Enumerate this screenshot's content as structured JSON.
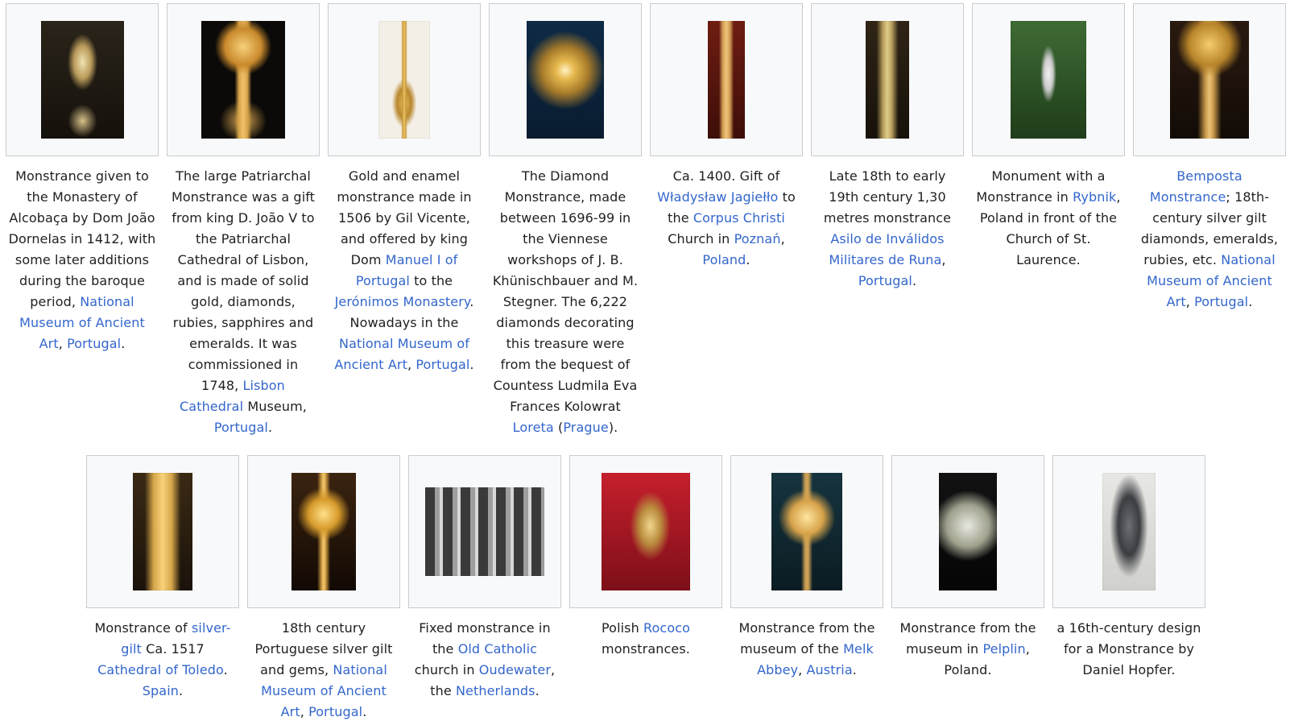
{
  "gallery": {
    "row1": [
      {
        "icon": "monstrance-image",
        "caption": [
          {
            "t": "Monstrance given to the Monastery of Alcobaça by Dom João Dornelas in 1412, with some later additions during the baroque period, ",
            "link": false
          },
          {
            "t": "National Museum of Ancient Art",
            "link": true
          },
          {
            "t": ", ",
            "link": false
          },
          {
            "t": "Portugal",
            "link": true
          },
          {
            "t": ".",
            "link": false
          }
        ]
      },
      {
        "icon": "monstrance-image",
        "caption": [
          {
            "t": "The large Patriarchal Monstrance was a gift from king D. João V to the Patriarchal Cathedral of Lisbon, and is made of solid gold, diamonds, rubies, sapphires and emeralds. It was commissioned in 1748, ",
            "link": false
          },
          {
            "t": "Lisbon Cathedral",
            "link": true
          },
          {
            "t": " Museum, ",
            "link": false
          },
          {
            "t": "Portugal",
            "link": true
          },
          {
            "t": ".",
            "link": false
          }
        ]
      },
      {
        "icon": "monstrance-image",
        "caption": [
          {
            "t": "Gold and enamel monstrance made in 1506 by Gil Vicente, and offered by king Dom ",
            "link": false
          },
          {
            "t": "Manuel I of Portugal",
            "link": true
          },
          {
            "t": " to the ",
            "link": false
          },
          {
            "t": "Jerónimos Monastery",
            "link": true
          },
          {
            "t": ". Nowadays in the ",
            "link": false
          },
          {
            "t": "National Museum of Ancient Art",
            "link": true
          },
          {
            "t": ", ",
            "link": false
          },
          {
            "t": "Portugal",
            "link": true
          },
          {
            "t": ".",
            "link": false
          }
        ]
      },
      {
        "icon": "monstrance-image",
        "caption": [
          {
            "t": "The Diamond Monstrance, made between 1696-99 in the Viennese workshops of J. B. Khünischbauer and M. Stegner. The 6,222 diamonds decorating this treasure were from the bequest of Countess Ludmila Eva Frances Kolowrat ",
            "link": false
          },
          {
            "t": "Loreta",
            "link": true
          },
          {
            "t": " (",
            "link": false
          },
          {
            "t": "Prague",
            "link": true
          },
          {
            "t": ").",
            "link": false
          }
        ]
      },
      {
        "icon": "monstrance-image",
        "caption": [
          {
            "t": "Ca. 1400. Gift of ",
            "link": false
          },
          {
            "t": "Władysław Jagiełło",
            "link": true
          },
          {
            "t": " to the ",
            "link": false
          },
          {
            "t": "Corpus Christi",
            "link": true
          },
          {
            "t": " Church in ",
            "link": false
          },
          {
            "t": "Poznań",
            "link": true
          },
          {
            "t": ", ",
            "link": false
          },
          {
            "t": "Poland",
            "link": true
          },
          {
            "t": ".",
            "link": false
          }
        ]
      },
      {
        "icon": "monstrance-image",
        "caption": [
          {
            "t": "Late 18th to early 19th century 1,30 metres monstrance ",
            "link": false
          },
          {
            "t": "Asilo de Inválidos Militares de Runa",
            "link": true
          },
          {
            "t": ", ",
            "link": false
          },
          {
            "t": "Portugal",
            "link": true
          },
          {
            "t": ".",
            "link": false
          }
        ]
      },
      {
        "icon": "monstrance-image",
        "caption": [
          {
            "t": "Monument with a Monstrance in ",
            "link": false
          },
          {
            "t": "Rybnik",
            "link": true
          },
          {
            "t": ", Poland in front of the Church of St. Laurence.",
            "link": false
          }
        ]
      },
      {
        "icon": "monstrance-image",
        "caption": [
          {
            "t": "Bemposta Monstrance",
            "link": true
          },
          {
            "t": "; 18th-century silver gilt diamonds, emeralds, rubies, etc. ",
            "link": false
          },
          {
            "t": "National Museum of Ancient Art",
            "link": true
          },
          {
            "t": ", ",
            "link": false
          },
          {
            "t": "Portugal",
            "link": true
          },
          {
            "t": ".",
            "link": false
          }
        ]
      }
    ],
    "row2": [
      {
        "icon": "monstrance-image",
        "caption": [
          {
            "t": "Monstrance of ",
            "link": false
          },
          {
            "t": "silver-gilt",
            "link": true
          },
          {
            "t": " Ca. 1517 ",
            "link": false
          },
          {
            "t": "Cathedral of Toledo",
            "link": true
          },
          {
            "t": ". ",
            "link": false
          },
          {
            "t": "Spain",
            "link": true
          },
          {
            "t": ".",
            "link": false
          }
        ]
      },
      {
        "icon": "monstrance-image",
        "caption": [
          {
            "t": "18th century Portuguese silver gilt and gems, ",
            "link": false
          },
          {
            "t": "National Museum of Ancient Art",
            "link": true
          },
          {
            "t": ", ",
            "link": false
          },
          {
            "t": "Portugal",
            "link": true
          },
          {
            "t": ".",
            "link": false
          }
        ]
      },
      {
        "icon": "monstrance-image",
        "caption": [
          {
            "t": "Fixed monstrance in the ",
            "link": false
          },
          {
            "t": "Old Catholic",
            "link": true
          },
          {
            "t": " church in ",
            "link": false
          },
          {
            "t": "Oudewater",
            "link": true
          },
          {
            "t": ", the ",
            "link": false
          },
          {
            "t": "Netherlands",
            "link": true
          },
          {
            "t": ".",
            "link": false
          }
        ]
      },
      {
        "icon": "monstrance-image",
        "caption": [
          {
            "t": "Polish ",
            "link": false
          },
          {
            "t": "Rococo",
            "link": true
          },
          {
            "t": " monstrances.",
            "link": false
          }
        ]
      },
      {
        "icon": "monstrance-image",
        "caption": [
          {
            "t": "Monstrance from the museum of the ",
            "link": false
          },
          {
            "t": "Melk Abbey",
            "link": true
          },
          {
            "t": ", ",
            "link": false
          },
          {
            "t": "Austria",
            "link": true
          },
          {
            "t": ".",
            "link": false
          }
        ]
      },
      {
        "icon": "monstrance-image",
        "caption": [
          {
            "t": "Monstrance from the museum in ",
            "link": false
          },
          {
            "t": "Pelplin",
            "link": true
          },
          {
            "t": ", Poland.",
            "link": false
          }
        ]
      },
      {
        "icon": "monstrance-image",
        "caption": [
          {
            "t": "a 16th-century design for a Monstrance by Daniel Hopfer.",
            "link": false
          }
        ]
      }
    ]
  },
  "colors": {
    "link": "#3366cc",
    "text": "#202122",
    "thumb_bg": "#f8f9fa",
    "thumb_border": "#c8ccd1"
  }
}
